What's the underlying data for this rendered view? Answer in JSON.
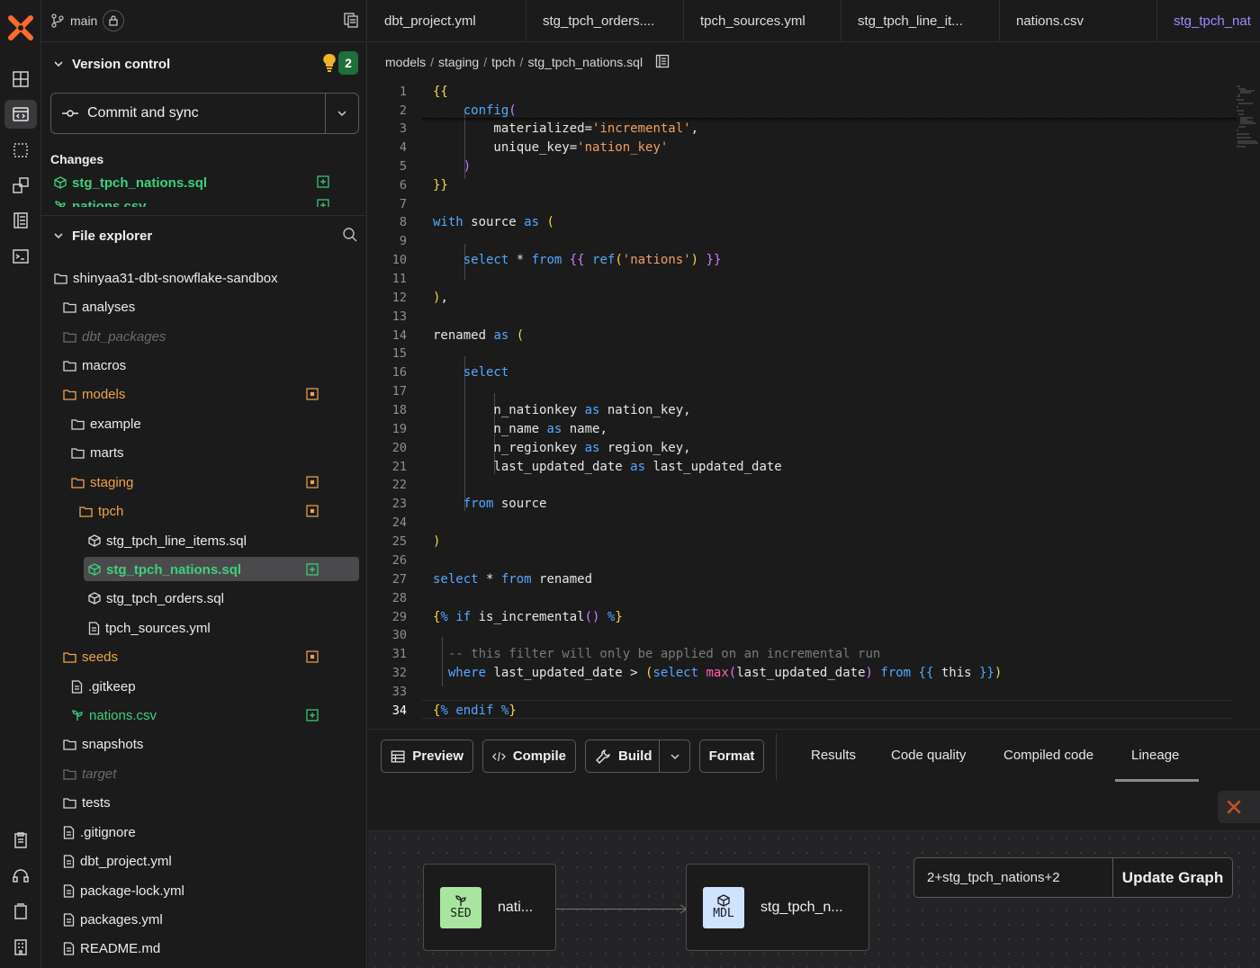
{
  "branch": {
    "name": "main"
  },
  "version_control": {
    "title": "Version control",
    "count": "2",
    "commit_label": "Commit and sync",
    "changes_title": "Changes",
    "changes": [
      "stg_tpch_nations.sql",
      "nations.csv"
    ]
  },
  "file_explorer": {
    "title": "File explorer",
    "root": "shinyaa31-dbt-snowflake-sandbox",
    "items": [
      {
        "name": "analyses"
      },
      {
        "name": "dbt_packages"
      },
      {
        "name": "macros"
      },
      {
        "name": "models"
      },
      {
        "name": "example"
      },
      {
        "name": "marts"
      },
      {
        "name": "staging"
      },
      {
        "name": "tpch"
      },
      {
        "name": "stg_tpch_line_items.sql"
      },
      {
        "name": "stg_tpch_nations.sql"
      },
      {
        "name": "stg_tpch_orders.sql"
      },
      {
        "name": "tpch_sources.yml"
      },
      {
        "name": "seeds"
      },
      {
        "name": ".gitkeep"
      },
      {
        "name": "nations.csv"
      },
      {
        "name": "snapshots"
      },
      {
        "name": "target"
      },
      {
        "name": "tests"
      },
      {
        "name": ".gitignore"
      },
      {
        "name": "dbt_project.yml"
      },
      {
        "name": "package-lock.yml"
      },
      {
        "name": "packages.yml"
      },
      {
        "name": "README.md"
      }
    ]
  },
  "tabs": [
    {
      "label": "dbt_project.yml"
    },
    {
      "label": "stg_tpch_orders...."
    },
    {
      "label": "tpch_sources.yml"
    },
    {
      "label": "stg_tpch_line_it..."
    },
    {
      "label": "nations.csv"
    },
    {
      "label": "stg_tpch_nat"
    }
  ],
  "breadcrumb": [
    "models",
    "staging",
    "tpch",
    "stg_tpch_nations.sql"
  ],
  "editor": {
    "line_numbers": [
      "1",
      "2",
      "3",
      "4",
      "5",
      "6",
      "7",
      "8",
      "9",
      "10",
      "11",
      "12",
      "13",
      "14",
      "15",
      "16",
      "17",
      "18",
      "19",
      "20",
      "21",
      "22",
      "23",
      "24",
      "25",
      "26",
      "27",
      "28",
      "29",
      "30",
      "31",
      "32",
      "33",
      "34"
    ],
    "current_line": "34"
  },
  "toolbar": {
    "preview": "Preview",
    "compile": "Compile",
    "build": "Build",
    "format": "Format",
    "result_tabs": [
      "Results",
      "Code quality",
      "Compiled code",
      "Lineage"
    ],
    "active_tab": "Lineage"
  },
  "lineage": {
    "node1": {
      "badge": "SED",
      "name": "nati..."
    },
    "node2": {
      "badge": "MDL",
      "name": "stg_tpch_n..."
    },
    "selector_value": "2+stg_tpch_nations+2",
    "update_label": "Update Graph"
  },
  "colors": {
    "accent": "#9b8cff",
    "added": "#3fd07a",
    "modified": "#f0a44a",
    "keyword": "#55a8ff",
    "string": "#f0a060",
    "brand": "#ff6a2a"
  }
}
